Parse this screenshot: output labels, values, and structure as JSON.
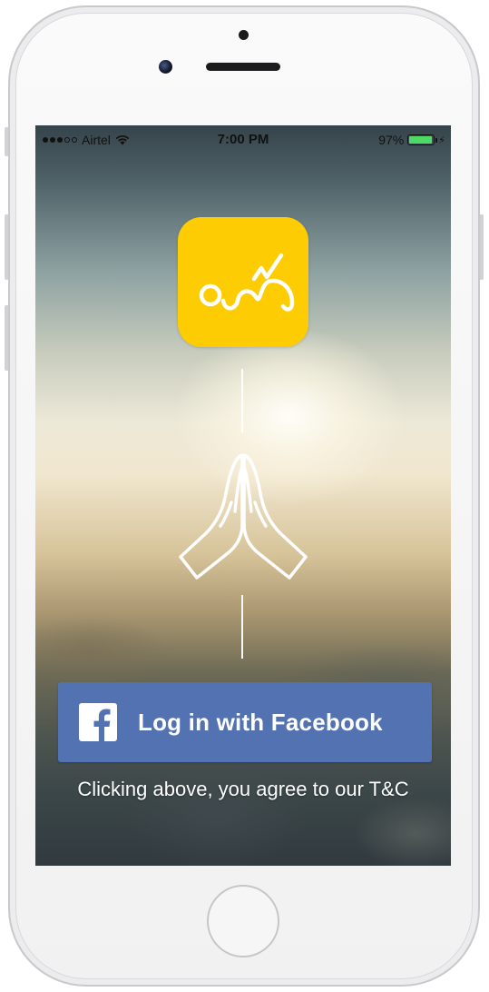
{
  "status_bar": {
    "carrier": "Airtel",
    "time": "7:00 PM",
    "battery_percent": "97%",
    "signal_bars_filled": 3,
    "signal_bars_total": 5,
    "battery_level": 0.97,
    "battery_color": "#4cd964"
  },
  "app_logo": {
    "icon": "telugu-script-logo-icon",
    "background_color": "#fdcc02"
  },
  "hero": {
    "icon": "praying-hands-icon"
  },
  "login": {
    "facebook_button_label": "Log in with Facebook",
    "facebook_icon": "facebook-icon",
    "button_color": "#5272b2"
  },
  "terms_text": "Clicking above, you agree to our T&C"
}
